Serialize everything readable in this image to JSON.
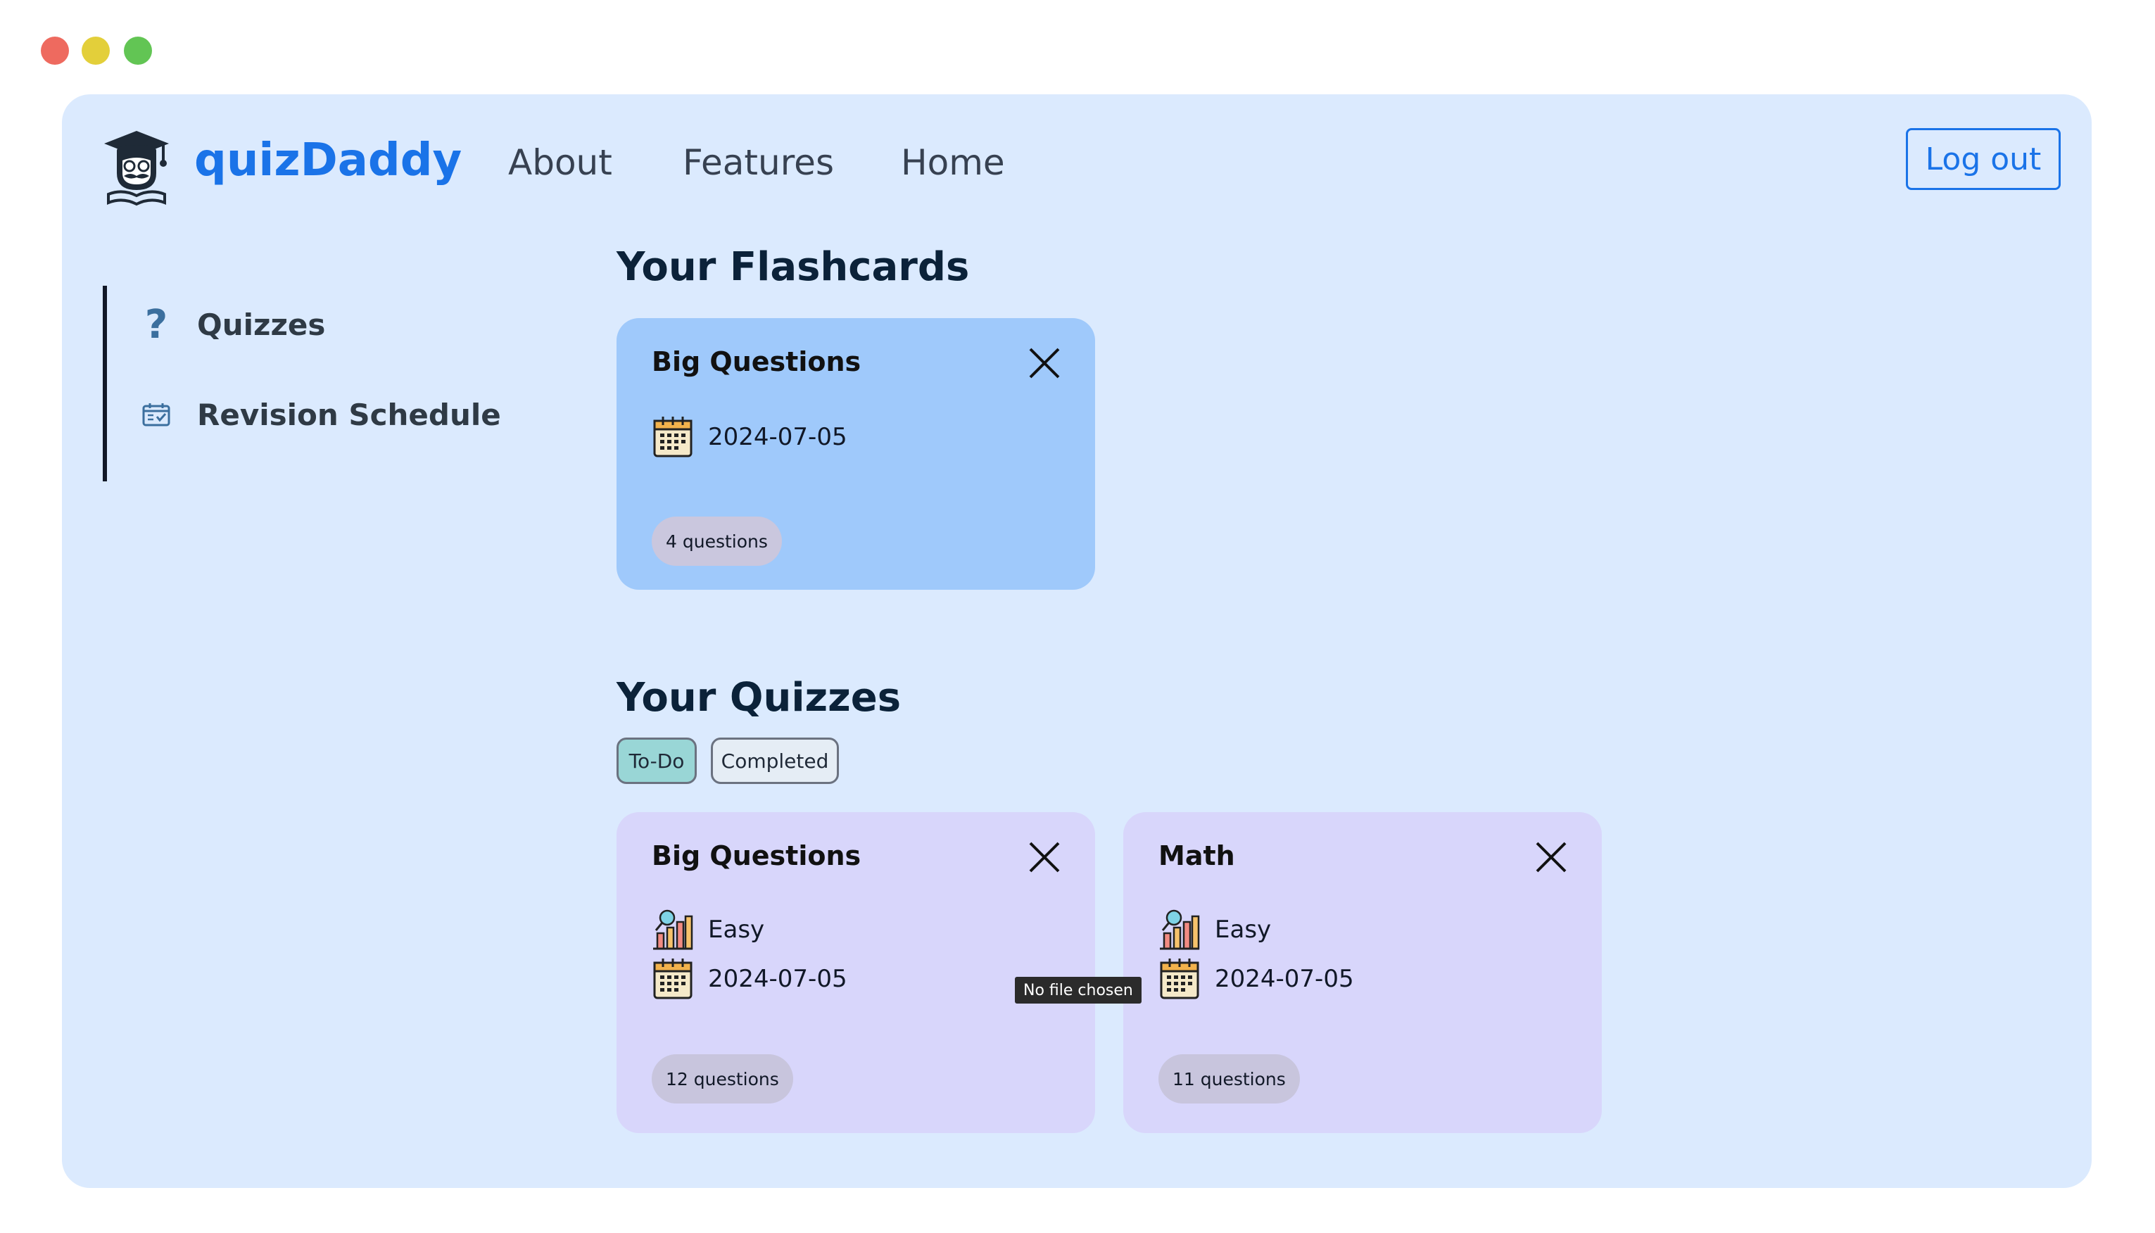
{
  "header": {
    "brand": "quizDaddy",
    "nav": [
      "About",
      "Features",
      "Home"
    ],
    "logout_label": "Log out",
    "logo_icon": "graduate-mascot-icon"
  },
  "sidebar": {
    "items": [
      {
        "label": "Quizzes",
        "icon": "question-mark-icon"
      },
      {
        "label": "Revision Schedule",
        "icon": "calendar-check-icon"
      }
    ]
  },
  "flashcards": {
    "title": "Your Flashcards",
    "cards": [
      {
        "title": "Big Questions",
        "date": "2024-07-05",
        "count": "4 questions"
      }
    ]
  },
  "quizzes": {
    "title": "Your Quizzes",
    "filters": [
      "To-Do",
      "Completed"
    ],
    "active_filter": "To-Do",
    "cards": [
      {
        "title": "Big Questions",
        "difficulty": "Easy",
        "date": "2024-07-05",
        "count": "12 questions"
      },
      {
        "title": "Math",
        "difficulty": "Easy",
        "date": "2024-07-05",
        "count": "11 questions"
      }
    ]
  },
  "tooltip": "No file chosen",
  "colors": {
    "accent": "#1a73e8",
    "app_bg": "#dbeafe",
    "flashcard_bg": "#9fc9fb",
    "quiz_card_bg": "#d8d6fb",
    "todo_active": "#99d6d6"
  }
}
